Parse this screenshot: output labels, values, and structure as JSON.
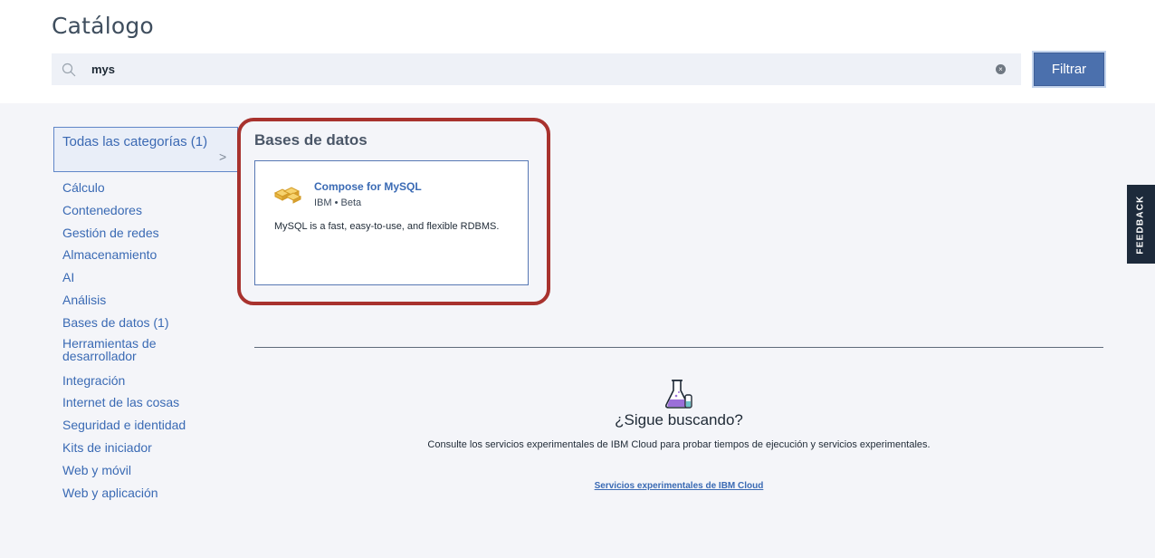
{
  "header": {
    "title": "Catálogo",
    "search": {
      "value": "mys",
      "icon": "search-icon",
      "clear_icon": "clear-icon"
    },
    "filter_label": "Filtrar"
  },
  "sidebar": {
    "active": {
      "label": "Todas las categorías (1)",
      "icon": "chevron-right-icon"
    },
    "items": [
      "Cálculo",
      "Contenedores",
      "Gestión de redes",
      "Almacenamiento",
      "AI",
      "Análisis",
      "Bases de datos (1)",
      "Herramientas de desarrollador",
      "Integración",
      "Internet de las cosas",
      "Seguridad e identidad",
      "Kits de iniciador",
      "Web y móvil",
      "Web y aplicación"
    ]
  },
  "results": {
    "section_title": "Bases de datos",
    "card": {
      "title": "Compose for MySQL",
      "subtitle": "IBM • Beta",
      "description": "MySQL is a fast, easy-to-use, and flexible RDBMS.",
      "icon": "compose-mysql-icon"
    }
  },
  "still_looking": {
    "icon": "flask-icon",
    "title": "¿Sigue buscando?",
    "description": "Consulte los servicios experimentales de IBM Cloud para probar tiempos de ejecución y servicios experimentales.",
    "link": "Servicios experimentales de IBM Cloud"
  },
  "feedback_label": "FEEDBACK",
  "colors": {
    "accent": "#4b70ad",
    "link": "#3a6ab4",
    "highlight": "#a8322e",
    "feedback_bg": "#1d2a3b"
  }
}
